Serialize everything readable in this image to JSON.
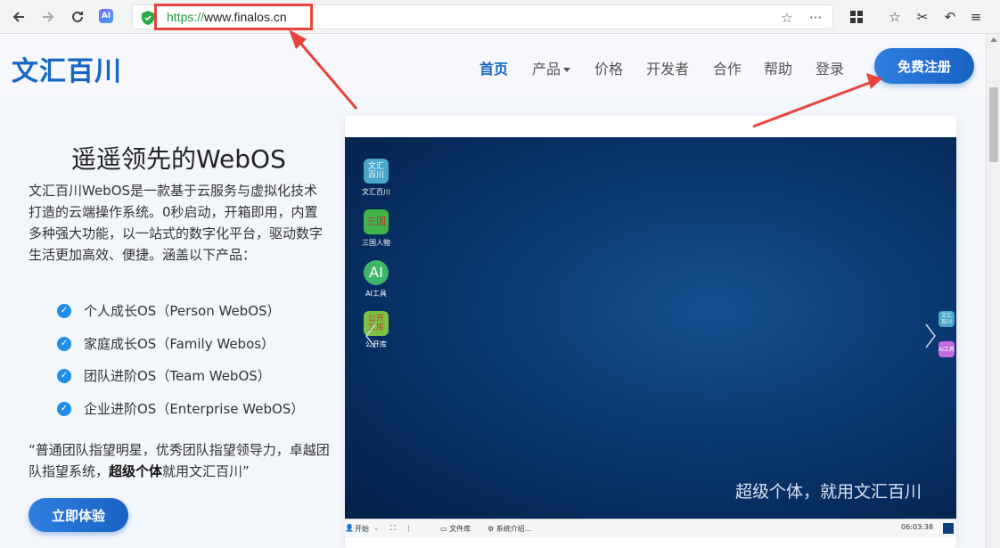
{
  "browser": {
    "url_scheme": "https://",
    "url_host": "www.finalos.cn",
    "ai_badge": "AI"
  },
  "site": {
    "logo": "文汇百川",
    "nav": [
      {
        "label": "首页"
      },
      {
        "label": "产品"
      },
      {
        "label": "价格"
      },
      {
        "label": "开发者"
      },
      {
        "label": "合作"
      },
      {
        "label": "帮助"
      },
      {
        "label": "登录"
      }
    ],
    "signup_label": "免费注册"
  },
  "hero": {
    "title": "遥遥领先的WebOS",
    "description": "文汇百川WebOS是一款基于云服务与虚拟化技术打造的云端操作系统。0秒启动，开箱即用，内置多种强大功能，以一站式的数字化平台，驱动数字生活更加高效、便捷。涵盖以下产品：",
    "features": [
      "个人成长OS（Person WebOS）",
      "家庭成长OS（Family Webos）",
      "团队进阶OS（Team WebOS）",
      "企业进阶OS（Enterprise WebOS）"
    ],
    "quote_prefix": "“普通团队指望明星，优秀团队指望领导力，卓越团队指望系统，",
    "quote_bold": "超级个体",
    "quote_suffix": "就用文汇百川”",
    "try_label": "立即体验"
  },
  "preview": {
    "icons": [
      {
        "box": "文汇\n百川",
        "label": "文汇百川",
        "color": "#4aa7c9"
      },
      {
        "box": "三国",
        "label": "三国人物",
        "color": "#3fb54a"
      },
      {
        "box": "AI",
        "label": "AI工具",
        "color": "#3fb56a"
      },
      {
        "box": "公开\n文库",
        "label": "公开库",
        "color": "#7cc242"
      }
    ],
    "side_icons": [
      {
        "box": "文汇\n百川",
        "color": "#4aa7c9"
      },
      {
        "box": "AI工具",
        "color": "#c46be0"
      }
    ],
    "slogan": "超级个体，就用文汇百川",
    "taskbar": {
      "start": "开始",
      "files": "文件库",
      "sysinfo": "系统介绍...",
      "clock": "06:03:38"
    }
  },
  "colors": {
    "brand": "#1666c5",
    "annotation": "#e8433c",
    "check": "#1e8ee8"
  }
}
